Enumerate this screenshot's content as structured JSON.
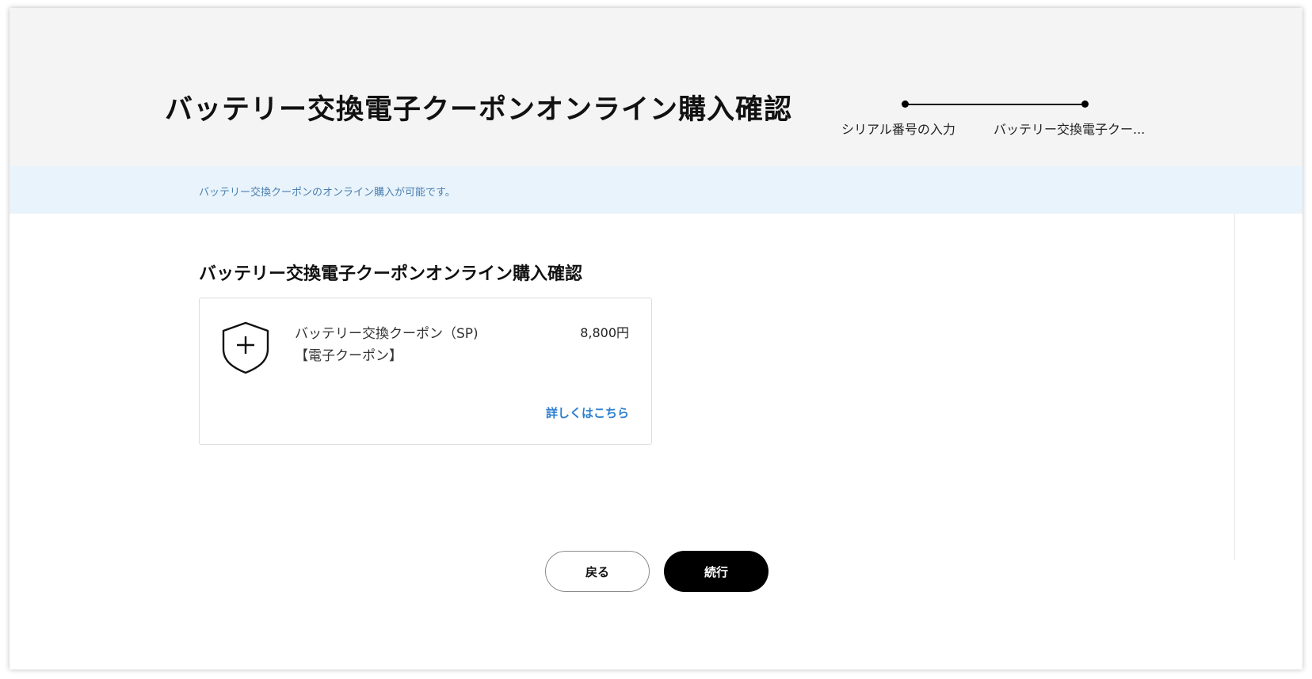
{
  "header": {
    "title": "バッテリー交換電子クーポンオンライン購入確認",
    "steps": [
      {
        "label": "シリアル番号の入力"
      },
      {
        "label": "バッテリー交換電子クー..."
      }
    ]
  },
  "notice": {
    "text": "バッテリー交換クーポンのオンライン購入が可能です。"
  },
  "main": {
    "section_title": "バッテリー交換電子クーポンオンライン購入確認",
    "coupon": {
      "icon": "shield-plus-icon",
      "name": "バッテリー交換クーポン（SP)",
      "type": "【電子クーポン】",
      "price": "8,800円",
      "details_link": "詳しくはこちら"
    }
  },
  "actions": {
    "back_label": "戻る",
    "continue_label": "続行"
  },
  "colors": {
    "header_bg": "#f4f4f4",
    "notice_bg": "#e8f3fb",
    "notice_text": "#4a7fb0",
    "link": "#2d7fd0",
    "primary_button": "#000000"
  }
}
